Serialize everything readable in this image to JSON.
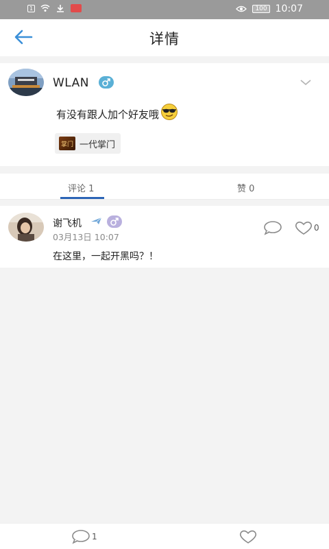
{
  "status_bar": {
    "time": "10:07",
    "battery": "100",
    "left_box": "1",
    "icons": [
      "sim-icon",
      "wifi-icon",
      "download-icon",
      "huawei-icon",
      "eye-icon",
      "battery-icon"
    ]
  },
  "header": {
    "title": "详情",
    "back_icon": "arrow-left-icon"
  },
  "post": {
    "author": "WLAN",
    "gender_icon": "male-icon",
    "content": "有没有跟人加个好友哦",
    "emoji": "sunglasses-emoji",
    "group_tag": {
      "logo_text": "掌门",
      "label": "一代掌门"
    }
  },
  "tabs": [
    {
      "label": "评论 1",
      "active": true
    },
    {
      "label": "赞 0",
      "active": false
    }
  ],
  "comments": [
    {
      "author": "谢飞机",
      "time": "03月13日 10:07",
      "text": "在这里，一起开黑吗？！",
      "like_count": "0"
    }
  ],
  "bottom_bar": {
    "comment_count": "1"
  },
  "colors": {
    "accent": "#2b64b6",
    "back_arrow": "#3a8fd8",
    "male_badge": "#5ab0d6",
    "neutral_badge": "#b9b0de",
    "status_bar": "#9a9a9a"
  }
}
